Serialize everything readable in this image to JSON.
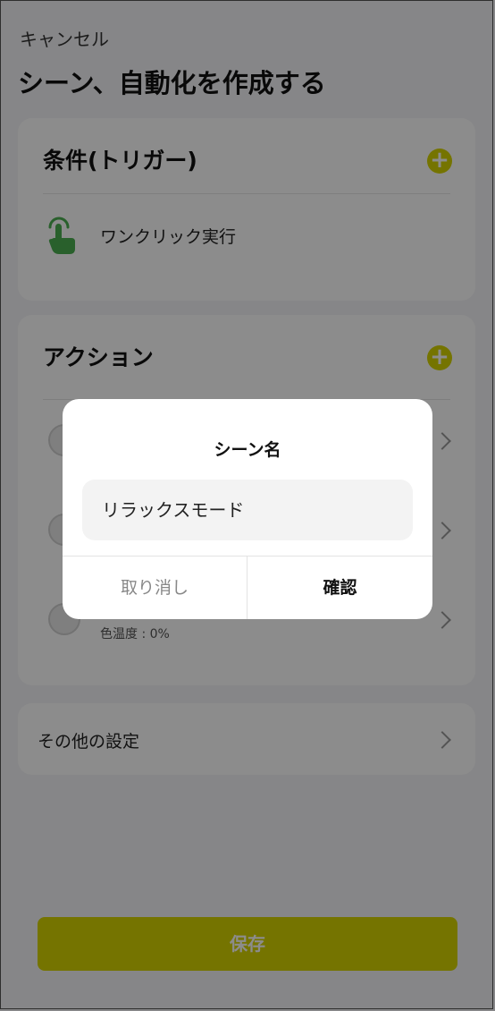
{
  "header": {
    "cancel_label": "キャンセル",
    "title": "シーン、自動化を作成する"
  },
  "trigger_card": {
    "title": "条件(トリガー)",
    "add_icon": "plus-icon",
    "item": {
      "icon": "tap-hand-icon",
      "label": "ワンクリック実行"
    }
  },
  "action_card": {
    "title": "アクション",
    "add_icon": "plus-icon",
    "rows": [
      {
        "icon": "bulb-icon",
        "subtitle": ""
      },
      {
        "icon": "bulb-icon",
        "subtitle": ""
      },
      {
        "icon": "bulb-icon",
        "subtitle": "色温度 : 0%"
      }
    ]
  },
  "other_settings": {
    "label": "その他の設定"
  },
  "save_label": "保存",
  "dialog": {
    "title": "シーン名",
    "input_value": "リラックスモード",
    "cancel_label": "取り消し",
    "confirm_label": "確認"
  },
  "colors": {
    "accent": "#d6d300",
    "trigger_icon": "#4caf50"
  }
}
